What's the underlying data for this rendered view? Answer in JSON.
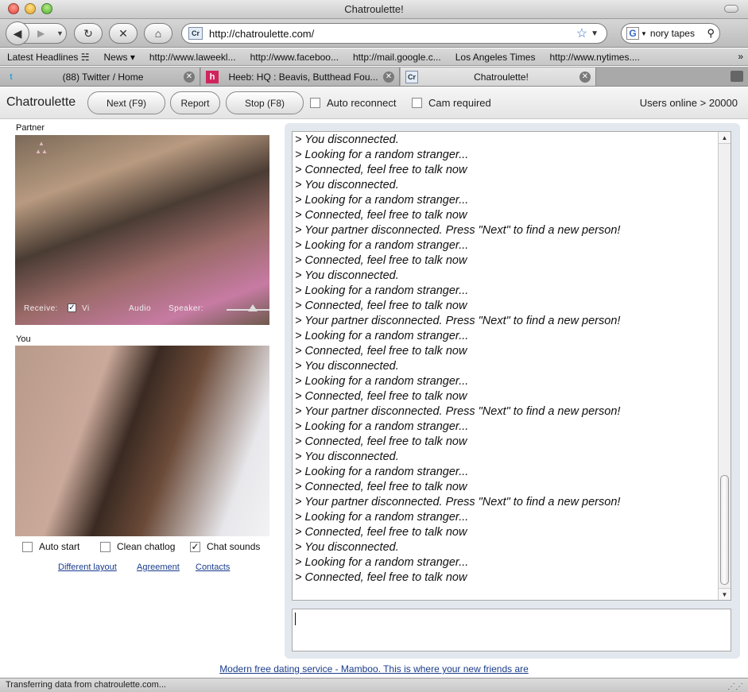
{
  "window": {
    "title": "Chatroulette!"
  },
  "browser": {
    "url": "http://chatroulette.com/",
    "site_badge": "Cr",
    "search_badge": "G",
    "search_value": "nory tapes",
    "bookmarks": [
      "Latest Headlines ☵",
      "News ▾",
      "http://www.laweekl...",
      "http://www.faceboo...",
      "http://mail.google.c...",
      "Los Angeles Times",
      "http://www.nytimes...."
    ],
    "bookmarks_more": "»",
    "tabs": [
      {
        "favicon": "t",
        "title": "(88) Twitter / Home"
      },
      {
        "favicon": "h",
        "title": "Heeb: HQ : Beavis, Butthead Fou..."
      },
      {
        "favicon": "Cr",
        "title": "Chatroulette!"
      }
    ],
    "status": "Transferring data from chatroulette.com..."
  },
  "app": {
    "brand": "Chatroulette",
    "next_label": "Next (F9)",
    "report_label": "Report",
    "stop_label": "Stop (F8)",
    "auto_reconnect_label": "Auto reconnect",
    "cam_required_label": "Cam required",
    "users_online": "Users online > 20000",
    "partner_label": "Partner",
    "you_label": "You",
    "receive_label": "Receive:",
    "video_label": "Vi",
    "audio_label": "Audio",
    "speaker_label": "Speaker:",
    "auto_start_label": "Auto start",
    "clean_chatlog_label": "Clean chatlog",
    "chat_sounds_label": "Chat sounds",
    "links": [
      "Different layout",
      "Agreement",
      "Contacts"
    ],
    "ad_text": "Modern free dating service - Mamboo. This is where your new friends are",
    "chat_log": [
      "> You disconnected.",
      "> Looking for a random stranger...",
      "> Connected, feel free to talk now",
      "> You disconnected.",
      "> Looking for a random stranger...",
      "> Connected, feel free to talk now",
      "> Your partner disconnected. Press \"Next\" to find a new person!",
      "> Looking for a random stranger...",
      "> Connected, feel free to talk now",
      "> You disconnected.",
      "> Looking for a random stranger...",
      "> Connected, feel free to talk now",
      "> Your partner disconnected. Press \"Next\" to find a new person!",
      "> Looking for a random stranger...",
      "> Connected, feel free to talk now",
      "> You disconnected.",
      "> Looking for a random stranger...",
      "> Connected, feel free to talk now",
      "> Your partner disconnected. Press \"Next\" to find a new person!",
      "> Looking for a random stranger...",
      "> Connected, feel free to talk now",
      "> You disconnected.",
      "> Looking for a random stranger...",
      "> Connected, feel free to talk now",
      "> Your partner disconnected. Press \"Next\" to find a new person!",
      "> Looking for a random stranger...",
      "> Connected, feel free to talk now",
      "> You disconnected.",
      "> Looking for a random stranger...",
      "> Connected, feel free to talk now"
    ],
    "checkbox_states": {
      "auto_reconnect": false,
      "cam_required": false,
      "auto_start": false,
      "clean_chatlog": false,
      "chat_sounds": true,
      "receive_video": true
    },
    "speaker_volume": 0.85
  }
}
